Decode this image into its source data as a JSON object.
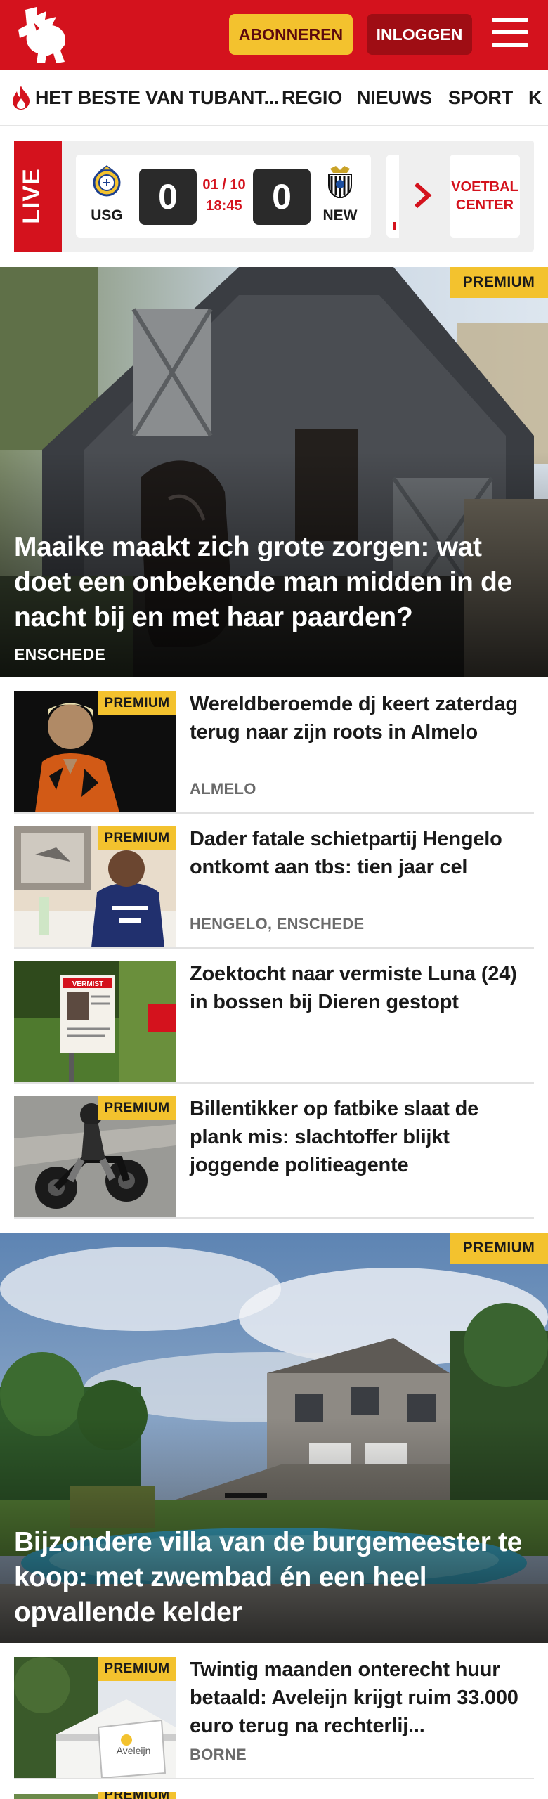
{
  "header": {
    "subscribe_label": "ABONNEREN",
    "login_label": "INLOGGEN",
    "brand_color": "#d4121d",
    "logo_icon": "tubantia-horse-logo-icon",
    "menu_icon": "hamburger-icon"
  },
  "nav": {
    "items": [
      {
        "label": "HET BESTE VAN TUBANT...",
        "icon": "flame-icon"
      },
      {
        "label": "REGIO"
      },
      {
        "label": "NIEUWS"
      },
      {
        "label": "SPORT"
      },
      {
        "label": "K"
      }
    ]
  },
  "live_widget": {
    "live_label": "LIVE",
    "match": {
      "home_team": "USG",
      "home_score": "0",
      "date": "01 / 10",
      "time": "18:45",
      "away_score": "0",
      "away_team": "NEW"
    },
    "next_icon": "chevron-right-icon",
    "center_label_line1": "VOETBAL",
    "center_label_line2": "CENTER"
  },
  "hero1": {
    "badge": "PREMIUM",
    "title": "Maaike maakt zich grote zorgen: wat doet een onbekende man midden in de nacht bij en met haar paarden?",
    "location": "ENSCHEDE"
  },
  "articles": [
    {
      "badge": "PREMIUM",
      "title": "Wereldberoemde dj keert zaterdag terug naar zijn roots in Almelo",
      "location": "ALMELO"
    },
    {
      "badge": "PREMIUM",
      "title": "Dader fatale schietpartij Hengelo ontkomt aan tbs: tien jaar cel",
      "location": "HENGELO, ENSCHEDE"
    },
    {
      "badge": "",
      "title": "Zoektocht naar vermiste Luna (24) in bossen bij Dieren gestopt",
      "location": "",
      "poster_text": "VERMIST"
    },
    {
      "badge": "PREMIUM",
      "title": "Billentikker op fatbike slaat de plank mis: slachtoffer blijkt joggende politieagente",
      "location": ""
    }
  ],
  "hero2": {
    "badge": "PREMIUM",
    "title": "Bijzondere villa van de burgemeester te koop: met zwembad én een heel opvallende kelder"
  },
  "articles2": [
    {
      "badge": "PREMIUM",
      "title": "Twintig maanden onterecht huur betaald: Aveleijn krijgt ruim 33.000 euro terug na rechterlij...",
      "location": "BORNE",
      "sign_text": "Aveleijn"
    },
    {
      "badge": "PREMIUM"
    }
  ]
}
